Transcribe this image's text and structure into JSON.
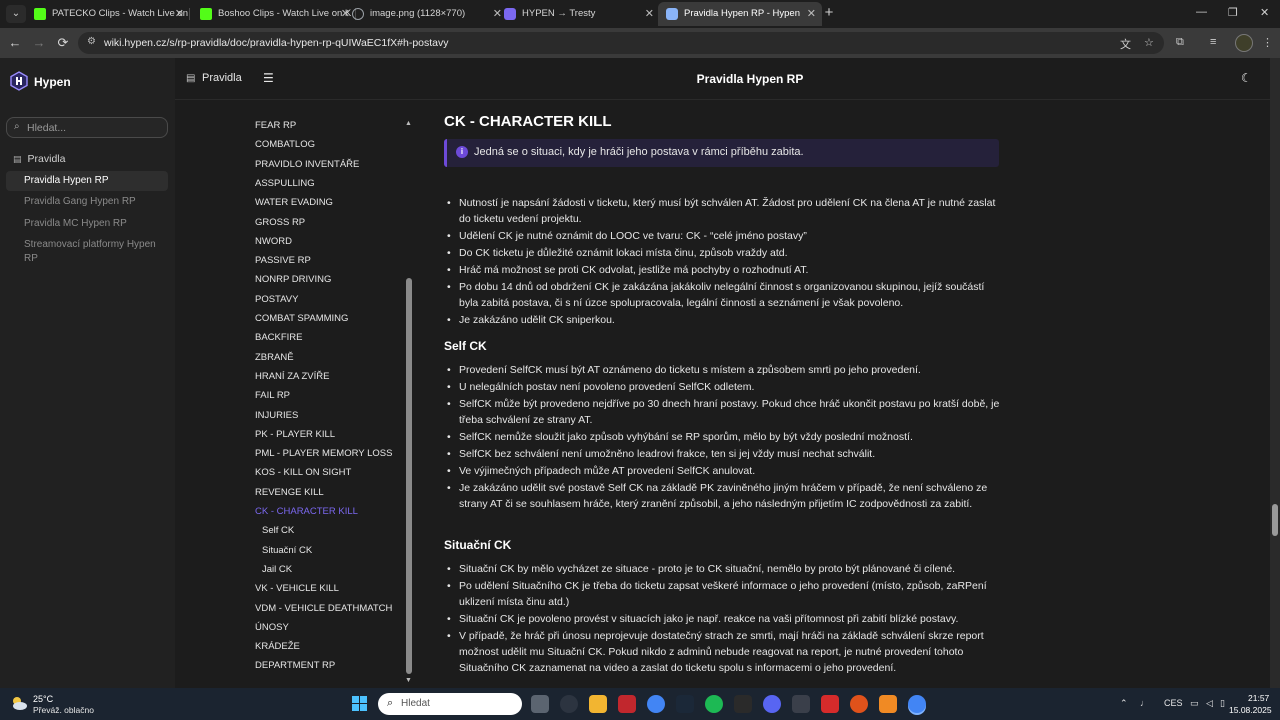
{
  "browser": {
    "tabs": [
      {
        "title": "PATECKO Clips - Watch Live on",
        "favicon_color": "#53fc18"
      },
      {
        "title": "Boshoo Clips - Watch Live on K",
        "favicon_color": "#53fc18"
      },
      {
        "title": "image.png (1128×770)",
        "favicon_color": "#9aa0a6"
      },
      {
        "title": "HYPEN → Tresty",
        "favicon_color": "#7b68f0"
      },
      {
        "title": "Pravidla Hypen RP - Hypen",
        "favicon_color": "#8ab4f8"
      }
    ],
    "url": "wiki.hypen.cz/s/rp-pravidla/doc/pravidla-hypen-rp-qUIWaEC1fX#h-postavy",
    "close_glyph": "✕",
    "new_tab_glyph": "+",
    "tab_menu_glyph": "⌄",
    "window_controls": {
      "minimize": "—",
      "restore": "❐",
      "close": "✕"
    },
    "nav_icons": {
      "back": "←",
      "forward": "→",
      "reload": "⟳"
    }
  },
  "sidebar": {
    "brand": "Hypen",
    "search_placeholder": "Hledat...",
    "section_label": "Pravidla",
    "items": [
      {
        "label": "Pravidla Hypen RP"
      },
      {
        "label": "Pravidla Gang Hypen RP"
      },
      {
        "label": "Pravidla MC Hypen RP"
      },
      {
        "label": "Streamovací platformy Hypen RP"
      }
    ]
  },
  "header": {
    "space_label": "Pravidla",
    "page_title": "Pravidla Hypen RP",
    "menu_glyph": "☰",
    "theme_glyph": "☾"
  },
  "toc": {
    "items": [
      "FEAR RP",
      "COMBATLOG",
      "PRAVIDLO INVENTÁŘE",
      "ASSPULLING",
      "WATER EVADING",
      "GROSS RP",
      "NWORD",
      "PASSIVE RP",
      "NONRP DRIVING",
      "POSTAVY",
      "COMBAT SPAMMING",
      "BACKFIRE",
      "ZBRANĚ",
      "HRANÍ ZA ZVÍŘE",
      "FAIL RP",
      "INJURIES",
      "PK - PLAYER KILL",
      "PML - PLAYER MEMORY LOSS",
      "KOS - KILL ON SIGHT",
      "REVENGE KILL",
      "CK - CHARACTER KILL",
      "Self CK",
      "Situační CK",
      "Jail CK",
      "VK - VEHICLE KILL",
      "VDM - VEHICLE DEATHMATCH",
      "ÚNOSY",
      "KRÁDEŽE",
      "DEPARTMENT RP"
    ],
    "current": "CK - CHARACTER KILL",
    "scroll_up": "▲",
    "scroll_down": "▼"
  },
  "article": {
    "heading": "CK - CHARACTER KILL",
    "callout": "Jedná se o situaci, kdy je hráči jeho postava v rámci příběhu zabita.",
    "main_bullets": [
      "Nutností je napsání žádosti v ticketu, který musí být schválen AT. Žádost pro udělení CK na člena AT je nutné zaslat do ticketu vedení projektu.",
      "Udělení CK je nutné oznámit do LOOC ve tvaru: CK - “celé jméno postavy”",
      "Do CK ticketu je důležité oznámit lokaci místa činu, způsob vraždy atd.",
      "Hráč má možnost se proti CK odvolat, jestliže má pochyby o rozhodnutí AT.",
      "Po dobu 14 dnů od obdržení CK je zakázána jakákoliv nelegální činnost s organizovanou skupinou, jejíž součástí byla zabitá postava, či s ní úzce spolupracovala, legální činnosti a seznámení je však povoleno.",
      "Je zakázáno udělit CK sniperkou."
    ],
    "self_ck": {
      "heading": "Self CK",
      "bullets": [
        "Provedení SelfCK musí být AT oznámeno do ticketu s místem a způsobem smrti po jeho provedení.",
        "U nelegálních postav není povoleno provedení SelfCK odletem.",
        "SelfCK může být provedeno nejdříve po 30 dnech hraní postavy. Pokud chce hráč ukončit postavu po kratší době, je třeba schválení ze strany AT.",
        "SelfCK nemůže sloužit jako způsob vyhýbání se RP sporům, mělo by být vždy poslední možností.",
        "SelfCK bez schválení není umožněno leadrovi frakce, ten si jej vždy musí nechat schválit.",
        "Ve výjimečných případech může AT provedení SelfCK anulovat.",
        "Je zakázáno udělit své postavě Self CK na základě PK zaviněného jiným hráčem v případě, že není schváleno ze strany AT či se souhlasem hráče, který zranění způsobil, a jeho následným přijetím IC zodpovědnosti za zabití."
      ]
    },
    "situacni_ck": {
      "heading": "Situační CK",
      "bullets": [
        "Situační CK by mělo vycházet ze situace - proto je to CK situační, nemělo by proto být plánované či cílené.",
        "Po udělení Situačního CK je třeba do ticketu zapsat veškeré informace o jeho provedení (místo, způsob, zaRPení uklizení místa činu atd.)",
        "Situační CK je povoleno provést v situacích jako je např. reakce na vaši přítomnost při zabití blízké postavy.",
        "V případě, že hráč při únosu neprojevuje dostatečný strach ze smrti, mají hráči na základě schválení skrze report možnost udělit mu Situační CK. Pokud nikdo z adminů nebude reagovat na report, je nutné provedení tohoto Situačního CK zaznamenat na video a zaslat do ticketu spolu s informacemi o jeho provedení."
      ]
    }
  },
  "taskbar": {
    "temperature": "25°C",
    "weather": "Převáž. oblačno",
    "search_label": "Hledat",
    "language": "CES",
    "time": "21:57",
    "date": "15.08.2025"
  }
}
